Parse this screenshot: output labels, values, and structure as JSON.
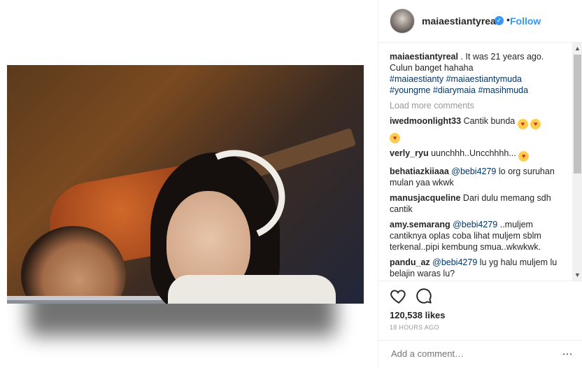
{
  "post": {
    "username": "maiaestiantyreal",
    "follow_label": "Follow",
    "dot": "•",
    "caption_user": "maiaestiantyreal",
    "caption_text": ". It was 21 years ago. Culun banget hahaha",
    "hashtags": [
      "#maiaestianty",
      "#maiaestiantymuda",
      "#youngme",
      "#diarymaia",
      "#masihmuda"
    ],
    "load_more": "Load more comments",
    "likes": "120,538 likes",
    "time": "18 HOURS AGO",
    "add_comment_placeholder": "Add a comment…",
    "more_icon": "…"
  },
  "comments": [
    {
      "user": "iwedmoonlight33",
      "text": "Cantik bunda"
    },
    {
      "user": "verly_ryu",
      "text": "uunchhh..Uncchhhh..."
    },
    {
      "user": "behatiazkiiaaa",
      "mention": "@bebi4279",
      "text": "lo org suruhan mulan yaa wkwk"
    },
    {
      "user": "manusjacqueline",
      "text": "Dari dulu memang sdh cantik"
    },
    {
      "user": "amy.semarang",
      "mention": "@bebi4279",
      "text": "..muljem cantiknya oplas coba lihat muljem sblm terkenal..pipi kembung smua..wkwkwk."
    },
    {
      "user": "pandu_az",
      "mention": "@bebi4279",
      "text": "lu yg halu muljem lu belajin waras lu?"
    }
  ],
  "scrollbar": {
    "up": "▲",
    "down": "▼"
  },
  "icons": {
    "verified": "✓",
    "heart": "heart-icon",
    "comment": "comment-icon"
  },
  "colors": {
    "accent": "#3897f0",
    "text": "#262626",
    "muted": "#999999",
    "hashtag": "#003569"
  }
}
